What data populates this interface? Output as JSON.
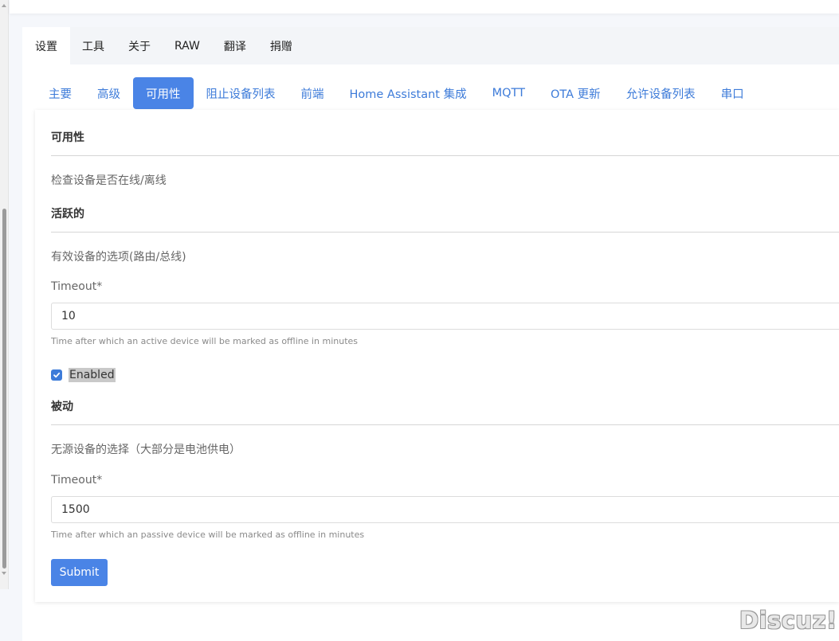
{
  "top_tabs": [
    "设置",
    "工具",
    "关于",
    "RAW",
    "翻译",
    "捐赠"
  ],
  "sub_tabs": [
    "主要",
    "高级",
    "可用性",
    "阻止设备列表",
    "前端",
    "Home Assistant 集成",
    "MQTT",
    "OTA 更新",
    "允许设备列表",
    "串口"
  ],
  "form": {
    "section_title": "可用性",
    "section_desc": "检查设备是否在线/离线",
    "active": {
      "title": "活跃的",
      "desc": "有效设备的选项(路由/总线)",
      "timeout_label": "Timeout*",
      "timeout_value": "10",
      "timeout_hint": "Time after which an active device will be marked as offline in minutes",
      "enabled_label": "Enabled",
      "enabled_checked": true
    },
    "passive": {
      "title": "被动",
      "desc": "无源设备的选择（大部分是电池供电）",
      "timeout_label": "Timeout*",
      "timeout_value": "1500",
      "timeout_hint": "Time after which an passive device will be marked as offline in minutes"
    },
    "submit_label": "Submit"
  },
  "watermark": "Discuz!",
  "colors": {
    "accent": "#4a84e6",
    "link": "#3d7bd9",
    "background": "#f5f7fb"
  }
}
